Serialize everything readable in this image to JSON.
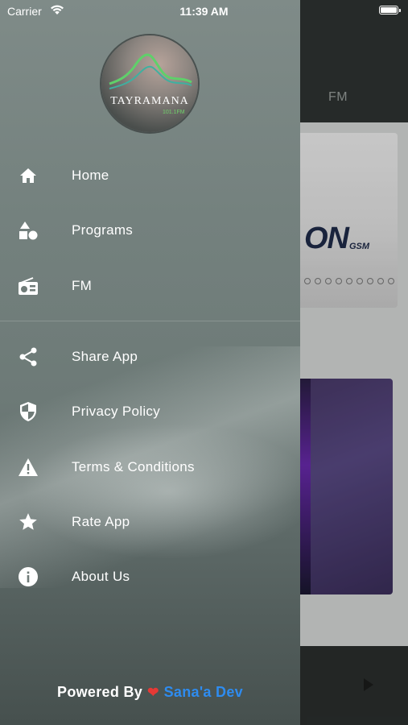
{
  "status_bar": {
    "carrier": "Carrier",
    "time": "11:39 AM"
  },
  "background": {
    "tab_label": "FM",
    "banner_brand": "ON",
    "banner_sub": "GSM"
  },
  "logo": {
    "name": "TAYRAMANA",
    "frequency": "101.1FM"
  },
  "menu": [
    {
      "label": "Home",
      "icon": "home-icon"
    },
    {
      "label": "Programs",
      "icon": "shapes-icon"
    },
    {
      "label": "FM",
      "icon": "radio-icon"
    },
    {
      "label": "Share App",
      "icon": "share-icon"
    },
    {
      "label": "Privacy Policy",
      "icon": "shield-icon"
    },
    {
      "label": "Terms & Conditions",
      "icon": "warning-icon"
    },
    {
      "label": "Rate App",
      "icon": "star-icon"
    },
    {
      "label": "About Us",
      "icon": "info-icon"
    }
  ],
  "footer": {
    "powered_by": "Powered By",
    "developer": "Sana'a Dev"
  },
  "colors": {
    "accent_link": "#2e8cf0",
    "heart": "#e53935",
    "logo_wave": "#5fd06a"
  }
}
